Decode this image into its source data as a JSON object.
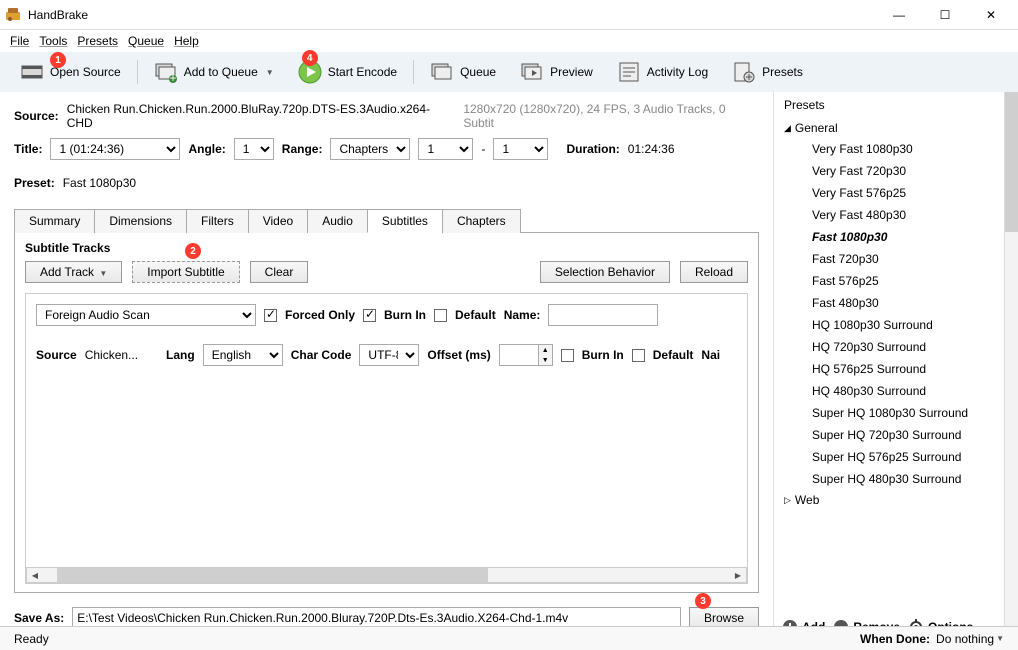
{
  "window": {
    "title": "HandBrake"
  },
  "menu": {
    "file": "File",
    "tools": "Tools",
    "presets": "Presets",
    "queue": "Queue",
    "help": "Help"
  },
  "toolbar": {
    "open_source": "Open Source",
    "add_queue": "Add to Queue",
    "start_encode": "Start Encode",
    "queue": "Queue",
    "preview": "Preview",
    "activity": "Activity Log",
    "presets": "Presets"
  },
  "badges": {
    "b1": "1",
    "b2": "2",
    "b3": "3",
    "b4": "4"
  },
  "source": {
    "label": "Source:",
    "name": "Chicken Run.Chicken.Run.2000.BluRay.720p.DTS-ES.3Audio.x264-CHD",
    "meta": "1280x720 (1280x720), 24 FPS, 3 Audio Tracks, 0 Subtit"
  },
  "title": {
    "label": "Title:",
    "value": "1  (01:24:36)",
    "angle_label": "Angle:",
    "angle": "1",
    "range_label": "Range:",
    "range_type": "Chapters",
    "range_from": "1",
    "range_sep": "-",
    "range_to": "1",
    "duration_label": "Duration:",
    "duration": "01:24:36"
  },
  "preset": {
    "label": "Preset:",
    "value": "Fast 1080p30"
  },
  "tabs": [
    "Summary",
    "Dimensions",
    "Filters",
    "Video",
    "Audio",
    "Subtitles",
    "Chapters"
  ],
  "active_tab": "Subtitles",
  "subtitles": {
    "heading": "Subtitle Tracks",
    "add_track": "Add Track",
    "import": "Import Subtitle",
    "clear": "Clear",
    "sel_behavior": "Selection Behavior",
    "reload": "Reload",
    "track_type": "Foreign Audio Scan",
    "forced": "Forced Only",
    "burn": "Burn In",
    "default": "Default",
    "name": "Name:",
    "src_label": "Source",
    "src_val": "Chicken...",
    "lang_label": "Lang",
    "lang_val": "English",
    "cc_label": "Char Code",
    "cc_val": "UTF-8",
    "offset_label": "Offset (ms)",
    "offset_val": "",
    "burn2": "Burn In",
    "default2": "Default",
    "name2": "Nai"
  },
  "save": {
    "label": "Save As:",
    "path": "E:\\Test Videos\\Chicken Run.Chicken.Run.2000.Bluray.720P.Dts-Es.3Audio.X264-Chd-1.m4v",
    "browse": "Browse"
  },
  "presets_panel": {
    "heading": "Presets",
    "cat_general": "General",
    "cat_web": "Web",
    "items": [
      "Very Fast 1080p30",
      "Very Fast 720p30",
      "Very Fast 576p25",
      "Very Fast 480p30",
      "Fast 1080p30",
      "Fast 720p30",
      "Fast 576p25",
      "Fast 480p30",
      "HQ 1080p30 Surround",
      "HQ 720p30 Surround",
      "HQ 576p25 Surround",
      "HQ 480p30 Surround",
      "Super HQ 1080p30 Surround",
      "Super HQ 720p30 Surround",
      "Super HQ 576p25 Surround",
      "Super HQ 480p30 Surround"
    ],
    "add": "Add",
    "remove": "Remove",
    "options": "Options"
  },
  "status": {
    "ready": "Ready",
    "when_done": "When Done:",
    "when_done_val": "Do nothing"
  }
}
